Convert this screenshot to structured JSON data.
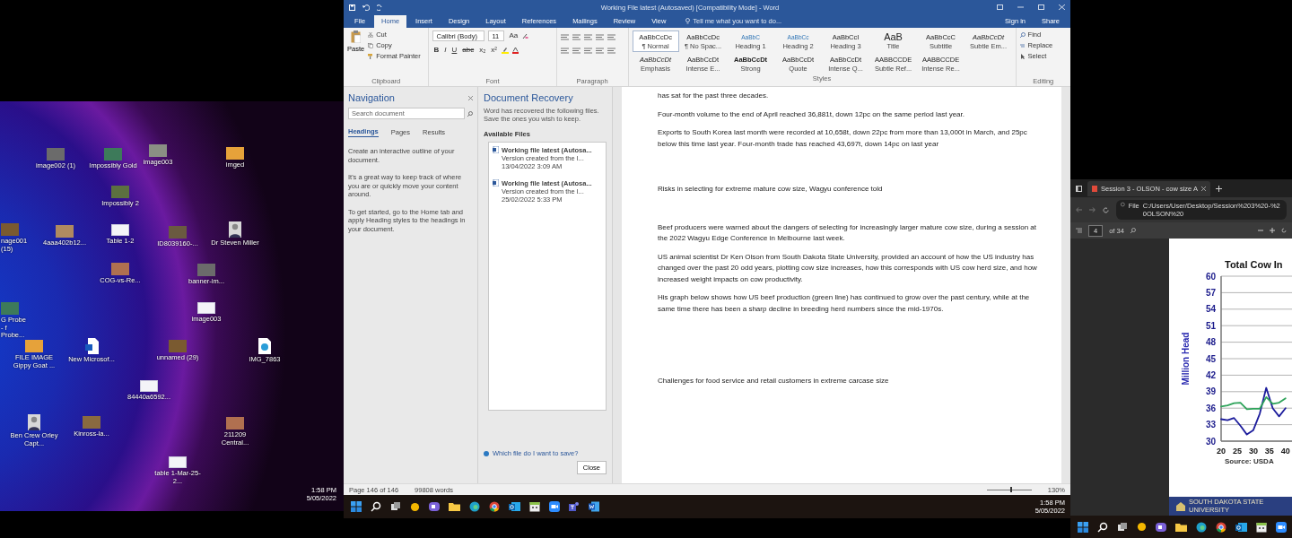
{
  "left_monitor": {
    "desktop_icons": [
      {
        "label": "image002 (1)",
        "kind": "photo"
      },
      {
        "label": "Impossibly Gold",
        "kind": "photo"
      },
      {
        "label": "image003",
        "kind": "photo"
      },
      {
        "label": "imged",
        "kind": "photo"
      },
      {
        "label": "Impossibly 2",
        "kind": "photo"
      },
      {
        "label": "nage001 (15)",
        "kind": "photo"
      },
      {
        "label": "4aaa402b12...",
        "kind": "photo"
      },
      {
        "label": "Table 1-2",
        "kind": "page"
      },
      {
        "label": "ID8039160-...",
        "kind": "photo"
      },
      {
        "label": "Dr Steven Miller",
        "kind": "portrait"
      },
      {
        "label": "COG-vs-Re...",
        "kind": "photo"
      },
      {
        "label": "banner-im...",
        "kind": "photo"
      },
      {
        "label": "G Probe - f Probe...",
        "kind": "photo"
      },
      {
        "label": "image003",
        "kind": "page"
      },
      {
        "label": "FILE IMAGE Gippy Goat ...",
        "kind": "photo"
      },
      {
        "label": "New Microsof...",
        "kind": "word"
      },
      {
        "label": "unnamed (29)",
        "kind": "photo"
      },
      {
        "label": "IMG_7863",
        "kind": "file"
      },
      {
        "label": "84440a6592...",
        "kind": "page"
      },
      {
        "label": "Ben Crew Orley Capt...",
        "kind": "portrait"
      },
      {
        "label": "Kinross-la...",
        "kind": "photo"
      },
      {
        "label": "211209 Central...",
        "kind": "photo"
      },
      {
        "label": "table 1-Mar-25-2...",
        "kind": "page"
      }
    ],
    "clock": {
      "time": "1:58 PM",
      "date": "5/05/2022"
    }
  },
  "word": {
    "title": "Working File latest (Autosaved) [Compatibility Mode] - Word",
    "ribbon_tabs": [
      {
        "label": "File",
        "selected": false
      },
      {
        "label": "Home",
        "selected": true
      },
      {
        "label": "Insert",
        "selected": false
      },
      {
        "label": "Design",
        "selected": false
      },
      {
        "label": "Layout",
        "selected": false
      },
      {
        "label": "References",
        "selected": false
      },
      {
        "label": "Mailings",
        "selected": false
      },
      {
        "label": "Review",
        "selected": false
      },
      {
        "label": "View",
        "selected": false
      }
    ],
    "tell_me": "Tell me what you want to do...",
    "sign_in": "Sign in",
    "share": "Share",
    "clipboard": {
      "paste": "Paste",
      "cut": "Cut",
      "copy": "Copy",
      "format_painter": "Format Painter",
      "label": "Clipboard"
    },
    "font": {
      "name": "Calibri (Body)",
      "size": "11",
      "case_button": "Aa",
      "format_buttons": [
        "B",
        "I",
        "U",
        "abc",
        "x₂",
        "x²"
      ],
      "label": "Font"
    },
    "paragraph": {
      "label": "Paragraph"
    },
    "styles": {
      "label": "Styles",
      "items": [
        {
          "preview": "AaBbCcDc",
          "name": "¶ Normal",
          "selected": true
        },
        {
          "preview": "AaBbCcDc",
          "name": "¶ No Spac...",
          "selected": false
        },
        {
          "preview": "AaBbC",
          "name": "Heading 1",
          "selected": false
        },
        {
          "preview": "AaBbCc",
          "name": "Heading 2",
          "selected": false
        },
        {
          "preview": "AaBbCcI",
          "name": "Heading 3",
          "selected": false
        },
        {
          "preview": "AaB",
          "name": "Title",
          "selected": false
        },
        {
          "preview": "AaBbCcC",
          "name": "Subtitle",
          "selected": false
        },
        {
          "preview": "AaBbCcDt",
          "name": "Subtle Em...",
          "selected": false
        },
        {
          "preview": "AaBbCcDt",
          "name": "Emphasis",
          "selected": false
        },
        {
          "preview": "AaBbCcDt",
          "name": "Intense E...",
          "selected": false
        },
        {
          "preview": "AaBbCcDt",
          "name": "Strong",
          "selected": false
        },
        {
          "preview": "AaBbCcDt",
          "name": "Quote",
          "selected": false
        },
        {
          "preview": "AaBbCcDt",
          "name": "Intense Q...",
          "selected": false
        },
        {
          "preview": "AABBCCDE",
          "name": "Subtle Ref...",
          "selected": false
        },
        {
          "preview": "AABBCCDE",
          "name": "Intense Re...",
          "selected": false
        }
      ]
    },
    "editing": {
      "find": "Find",
      "replace": "Replace",
      "select": "Select",
      "label": "Editing"
    },
    "navigation": {
      "title": "Navigation",
      "search_placeholder": "Search document",
      "tabs": [
        {
          "label": "Headings",
          "selected": true
        },
        {
          "label": "Pages",
          "selected": false
        },
        {
          "label": "Results",
          "selected": false
        }
      ],
      "help": [
        "Create an interactive outline of your document.",
        "It's a great way to keep track of where you are or quickly move your content around.",
        "To get started, go to the Home tab and apply Heading styles to the headings in your document."
      ]
    },
    "recovery": {
      "title": "Document Recovery",
      "description": "Word has recovered the following files. Save the ones you wish to keep.",
      "files_label": "Available Files",
      "files": [
        {
          "name": "Working file latest (Autosa...",
          "note": "Version created from the l...",
          "date": "13/04/2022 3:09 AM"
        },
        {
          "name": "Working file latest (Autosa...",
          "note": "Version created from the l...",
          "date": "25/02/2022 5:33 PM"
        }
      ],
      "help_link": "Which file do I want to save?",
      "close": "Close"
    },
    "document": {
      "paragraphs": [
        {
          "kind": "body",
          "text": "has sat for the past three decades."
        },
        {
          "kind": "body",
          "text": "Four-month volume to the end of April reached 36,881t, down 12pc on the same period last year."
        },
        {
          "kind": "body",
          "text": "Exports to South Korea last month were recorded at 10,658t, down 22pc from more than 13,000t in March, and 25pc below this time last year. Four-month trade has reached 43,697t, down 14pc on last year"
        },
        {
          "kind": "heading",
          "text": "Risks in selecting for extreme mature cow size, Wagyu conference told"
        },
        {
          "kind": "body",
          "text": "Beef producers were warned about the dangers of selecting for increasingly larger mature cow size, during a session at the 2022 Wagyu Edge Conference in Melbourne last week."
        },
        {
          "kind": "body",
          "text": "US animal scientist Dr Ken Olson from South Dakota State University, provided an account of how the US industry has changed over the past 20 odd years, plotting cow size increases, how this corresponds with US cow herd size, and how increased weight impacts on cow productivity."
        },
        {
          "kind": "body",
          "text": "His graph below shows how US beef production (green line) has continued to grow over the past century, while at the same time there has been a sharp decline in breeding herd numbers since the mid-1970s."
        },
        {
          "kind": "heading",
          "text": "Challenges for food service and retail customers in extreme carcase size"
        }
      ]
    },
    "status_bar": {
      "page": "Page 146 of 146",
      "words": "99808 words",
      "zoom_slider": {
        "level": 0.52
      },
      "zoom": "130%"
    }
  },
  "taskbar": {
    "time": "1:58 PM",
    "date": "5/05/2022"
  },
  "browser": {
    "tab": "Session 3 - OLSON - cow size A",
    "site_label": "File",
    "url": "C:/Users/User/Desktop/Session%203%20-%20OLSON%20",
    "page": "4",
    "page_count": "of 34",
    "chart_data": {
      "type": "line",
      "title": "Total Cow In",
      "ylabel": "Million Head",
      "x": [
        20,
        22,
        24,
        26,
        28,
        30,
        32,
        34,
        36,
        38,
        40
      ],
      "series": [
        {
          "color": "#1c1c9c",
          "values": [
            34,
            33.8,
            34.2,
            32.8,
            31.2,
            32,
            35,
            39.7,
            36,
            34.5,
            36
          ]
        },
        {
          "color": "#2ea35a",
          "values": [
            36.3,
            36.5,
            36.9,
            37,
            35.8,
            35.9,
            35.9,
            38,
            36.8,
            37,
            37.8
          ]
        }
      ],
      "xlim": [
        20,
        42
      ],
      "ylim": [
        30,
        60
      ],
      "grid": true,
      "xticks": [
        20,
        25,
        30,
        35,
        40
      ],
      "yticks": [
        30,
        33,
        36,
        39,
        42,
        45,
        48,
        51,
        54,
        57,
        60
      ]
    },
    "source": "Source: USDA",
    "footer": "SOUTH DAKOTA STATE UNIVERSITY"
  }
}
